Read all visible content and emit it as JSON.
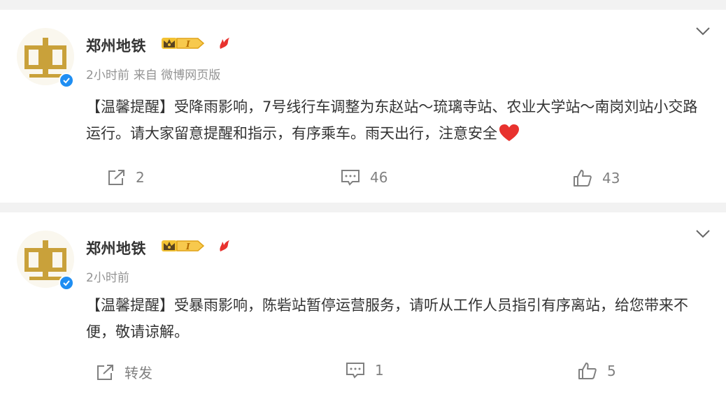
{
  "posts": [
    {
      "author": "郑州地铁",
      "time": "2小时前",
      "source": "来自 微博网页版",
      "content": "【温馨提醒】受降雨影响，7号线行车调整为东赵站～琉璃寺站、农业大学站～南岗刘站小交路运行。请大家留意提醒和指示，有序乘车。雨天出行，注意安全",
      "repost": "2",
      "comments": "46",
      "likes": "43"
    },
    {
      "author": "郑州地铁",
      "time": "2小时前",
      "content": "【温馨提醒】受暴雨影响，陈砦站暂停运营服务，请听从工作人员指引有序离站，给您带来不便，敬请谅解。",
      "repost": "转发",
      "comments": "1",
      "likes": "5"
    }
  ],
  "badges": {
    "crown_level": "1"
  },
  "colors": {
    "verified": "#1f8ef2",
    "logo_gold": "#c9a13a",
    "flame": "#e8322e",
    "heart": "#e8322e"
  },
  "icons": [
    "chevron-down-icon",
    "repost-icon",
    "comment-icon",
    "like-icon",
    "verified-icon",
    "crown-badge-icon",
    "flame-icon",
    "heart-icon"
  ]
}
